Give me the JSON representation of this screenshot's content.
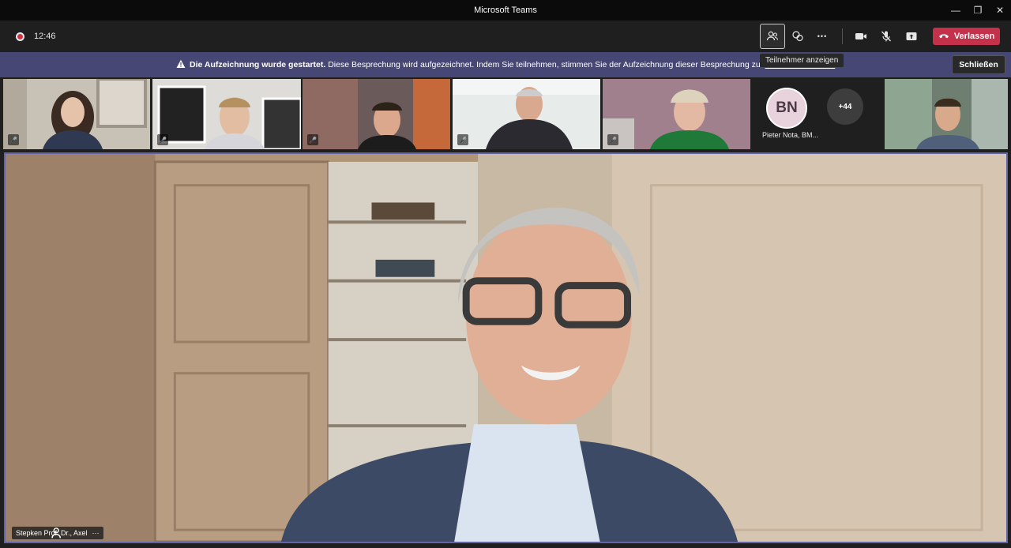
{
  "window": {
    "title": "Microsoft Teams",
    "minimize": "—",
    "restore": "❐",
    "close": "✕"
  },
  "toolbar": {
    "timer": "12:46",
    "participants_tooltip": "Teilnehmer anzeigen",
    "more_icon": "•••",
    "leave_label": "Verlassen"
  },
  "banner": {
    "bold": "Die Aufzeichnung wurde gestartet.",
    "message": " Diese Besprechung wird aufgezeichnet. Indem Sie teilnehmen, stimmen Sie der Aufzeichnung dieser Besprechung zu. ",
    "link": "Datenschutzrichtlin",
    "close_label": "Schließen"
  },
  "participants": {
    "avatar_initials": "BN",
    "avatar_name": "Pieter Nota, BM...",
    "overflow_count": "+44",
    "muted_icon": "🎤"
  },
  "main": {
    "speaker_name": "Stepken Prof. Dr., Axel",
    "more_icon": "···"
  },
  "colors": {
    "accent": "#6264a7",
    "banner": "#464775",
    "leave": "#c4314b"
  }
}
